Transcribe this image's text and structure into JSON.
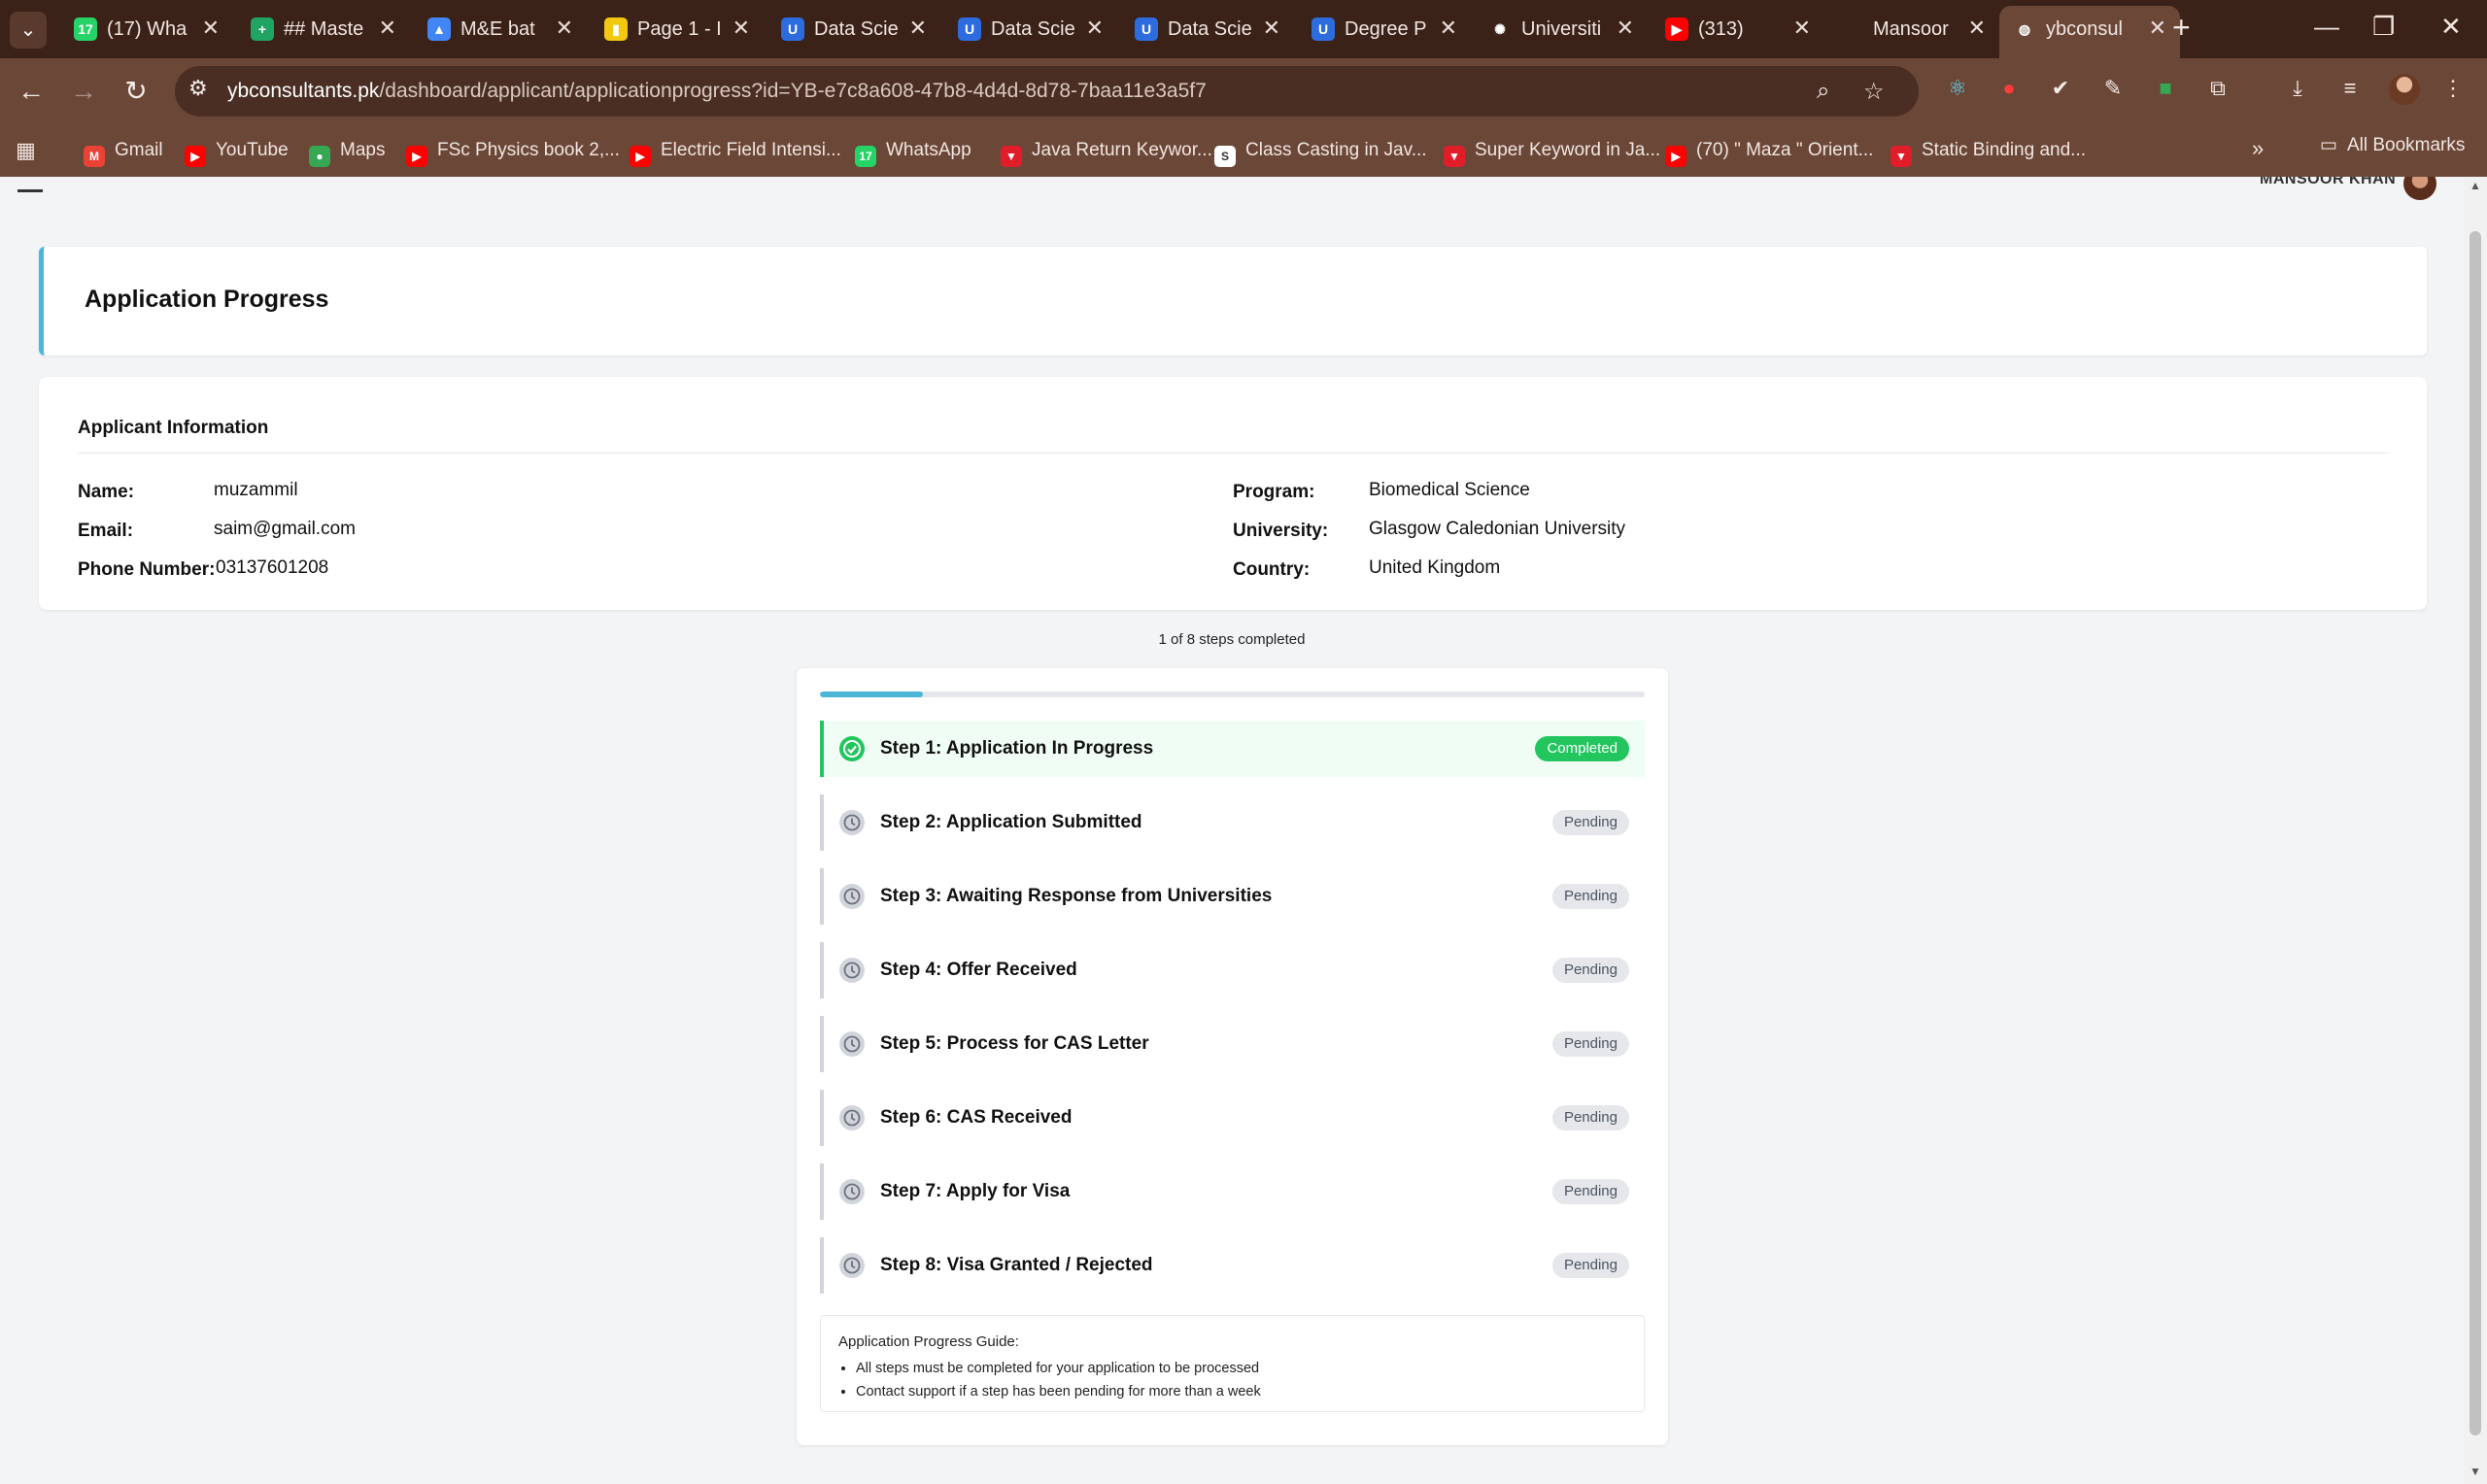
{
  "browser": {
    "tabs": [
      {
        "title": "(17) Wha",
        "icon": "whatsapp-icon",
        "color": "#25d366",
        "glyph": "17"
      },
      {
        "title": "## Maste",
        "icon": "sheets-icon",
        "color": "#1fa463",
        "glyph": "+"
      },
      {
        "title": "M&E bat",
        "icon": "drive-icon",
        "color": "#4285f4",
        "glyph": "▲"
      },
      {
        "title": "Page 1 - I",
        "icon": "powerbi-icon",
        "color": "#f2c811",
        "glyph": "▮"
      },
      {
        "title": "Data Scie",
        "icon": "uni-icon",
        "color": "#2d6cdf",
        "glyph": "U"
      },
      {
        "title": "Data Scie",
        "icon": "uni-icon",
        "color": "#2d6cdf",
        "glyph": "U"
      },
      {
        "title": "Data Scie",
        "icon": "uni-icon",
        "color": "#2d6cdf",
        "glyph": "U"
      },
      {
        "title": "Degree P",
        "icon": "uni-icon",
        "color": "#2d6cdf",
        "glyph": "U"
      },
      {
        "title": "Universiti",
        "icon": "openai-icon",
        "color": "#3b2218",
        "glyph": "✺"
      },
      {
        "title": "(313)",
        "icon": "youtube-icon",
        "color": "#ff0000",
        "glyph": "▶"
      },
      {
        "title": "Mansoor",
        "icon": "blank-icon",
        "color": "#3b2218",
        "glyph": ""
      },
      {
        "title": "ybconsul",
        "icon": "globe-icon",
        "color": "#6b4738",
        "glyph": "◍"
      }
    ],
    "url_host": "ybconsultants.pk",
    "url_path": "/dashboard/applicant/applicationprogress?id=YB-e7c8a608-47b8-4d4d-8d78-7baa11e3a5f7",
    "bookmarks": [
      {
        "label": "Gmail",
        "color": "#ea4335",
        "glyph": "M"
      },
      {
        "label": "YouTube",
        "color": "#ff0000",
        "glyph": "▶"
      },
      {
        "label": "Maps",
        "color": "#34a853",
        "glyph": "●"
      },
      {
        "label": "FSc Physics book 2,...",
        "color": "#ff0000",
        "glyph": "▶"
      },
      {
        "label": "Electric Field Intensi...",
        "color": "#ff0000",
        "glyph": "▶"
      },
      {
        "label": "WhatsApp",
        "color": "#25d366",
        "glyph": "17"
      },
      {
        "label": "Java Return Keywor...",
        "color": "#e11d2a",
        "glyph": "▼"
      },
      {
        "label": "Class Casting in Jav...",
        "color": "#ffffff",
        "glyph": "S"
      },
      {
        "label": "Super Keyword in Ja...",
        "color": "#e11d2a",
        "glyph": "▼"
      },
      {
        "label": "(70) \" Maza \" Orient...",
        "color": "#ff0000",
        "glyph": "▶"
      },
      {
        "label": "Static Binding and...",
        "color": "#e11d2a",
        "glyph": "▼"
      }
    ],
    "all_bookmarks": "All Bookmarks"
  },
  "header": {
    "user_name": "MANSOOR KHAN"
  },
  "page": {
    "title": "Application Progress",
    "applicant_info": {
      "heading": "Applicant Information",
      "name_label": "Name:",
      "name": "muzammil",
      "email_label": "Email:",
      "email": "saim@gmail.com",
      "phone_label": "Phone Number:",
      "phone": "03137601208",
      "program_label": "Program:",
      "program": "Biomedical Science",
      "university_label": "University:",
      "university": "Glasgow Caledonian University",
      "country_label": "Country:",
      "country": "United Kingdom"
    },
    "steps_summary": "1 of 8 steps completed",
    "progress_fraction": 0.125,
    "steps": [
      {
        "label": "Step 1: Application In Progress",
        "status": "Completed",
        "done": true
      },
      {
        "label": "Step 2: Application Submitted",
        "status": "Pending",
        "done": false
      },
      {
        "label": "Step 3: Awaiting Response from Universities",
        "status": "Pending",
        "done": false
      },
      {
        "label": "Step 4: Offer Received",
        "status": "Pending",
        "done": false
      },
      {
        "label": "Step 5: Process for CAS Letter",
        "status": "Pending",
        "done": false
      },
      {
        "label": "Step 6: CAS Received",
        "status": "Pending",
        "done": false
      },
      {
        "label": "Step 7: Apply for Visa",
        "status": "Pending",
        "done": false
      },
      {
        "label": "Step 8: Visa Granted / Rejected",
        "status": "Pending",
        "done": false
      }
    ],
    "guide": {
      "title": "Application Progress Guide:",
      "items": [
        "All steps must be completed for your application to be processed",
        "Contact support if a step has been pending for more than a week"
      ]
    }
  }
}
